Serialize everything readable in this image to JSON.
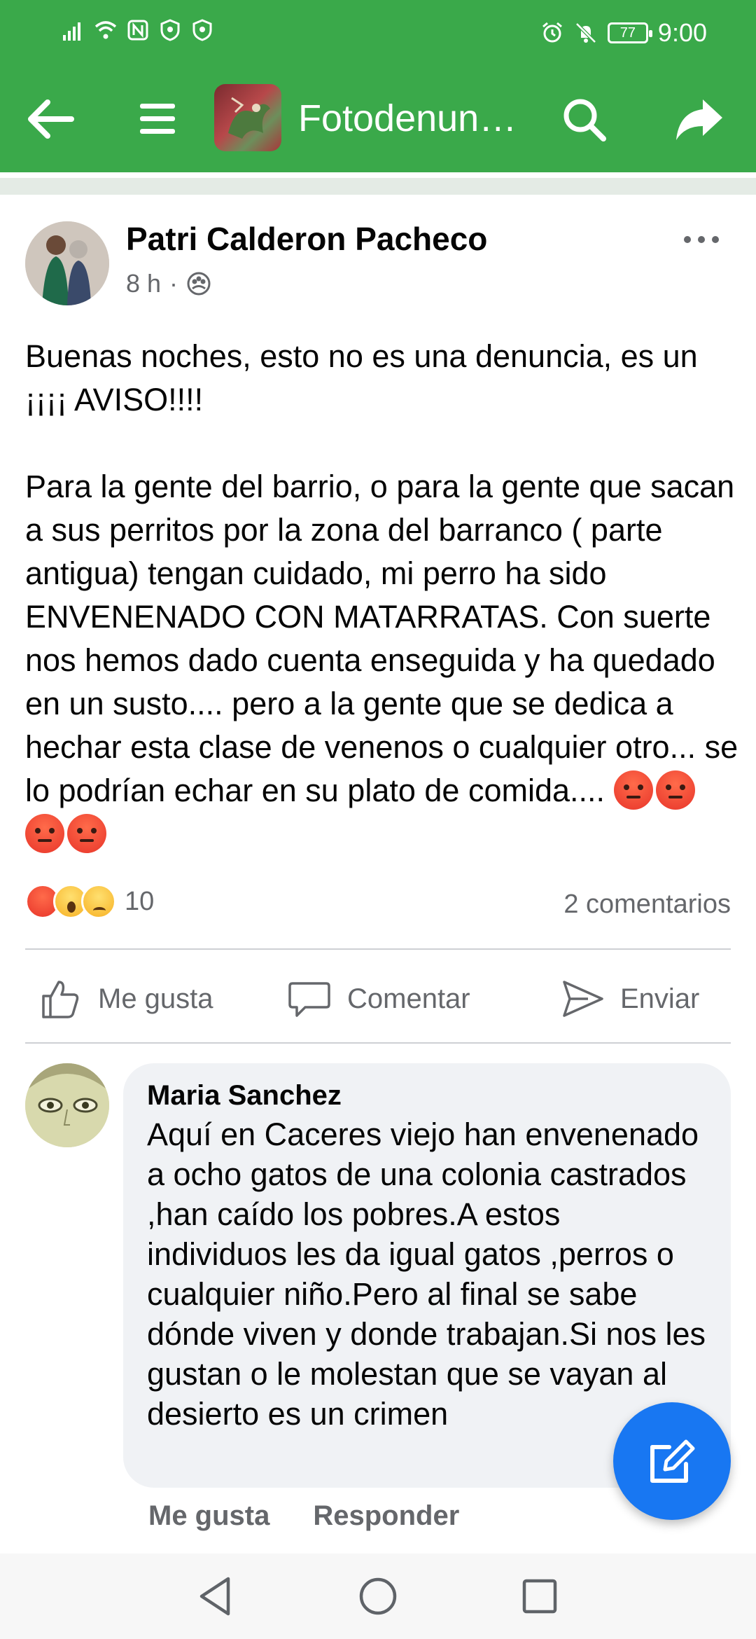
{
  "status_bar": {
    "time": "9:00",
    "battery": "77"
  },
  "app_bar": {
    "title": "Fotodenun…"
  },
  "post": {
    "author": "Patri Calderon Pacheco",
    "time": "8 h",
    "separator": "·",
    "body_lines_1": "Buenas noches, esto no es una denuncia, es un ¡¡¡¡ AVISO!!!!",
    "body_lines_2": "Para la gente del barrio, o para la gente que sacan a sus perritos por la zona del barranco ( parte antigua) tengan cuidado, mi perro ha sido ENVENENADO CON MATARRATAS. Con suerte nos hemos dado cuenta enseguida y ha quedado en un susto.... pero a la gente que se dedica a hechar esta clase de venenos o cualquier otro... se lo podrían echar en su plato de comida....",
    "reaction_count": "10",
    "comments_count": "2 comentarios"
  },
  "actions": {
    "like": "Me gusta",
    "comment": "Comentar",
    "send": "Enviar"
  },
  "comment": {
    "author": "Maria Sanchez",
    "text": "Aquí en Caceres viejo han envenenado a ocho gatos de una colonia castrados ,han caído los pobres.A estos individuos les da igual gatos ,perros o cualquier niño.Pero al final se sabe dónde viven y donde trabajan.Si nos les gustan o le molestan que se vayan al desierto es un crimen",
    "like": "Me gusta",
    "reply": "Responder"
  },
  "colors": {
    "app_green": "#3aa94a",
    "fab_blue": "#1877f2"
  }
}
